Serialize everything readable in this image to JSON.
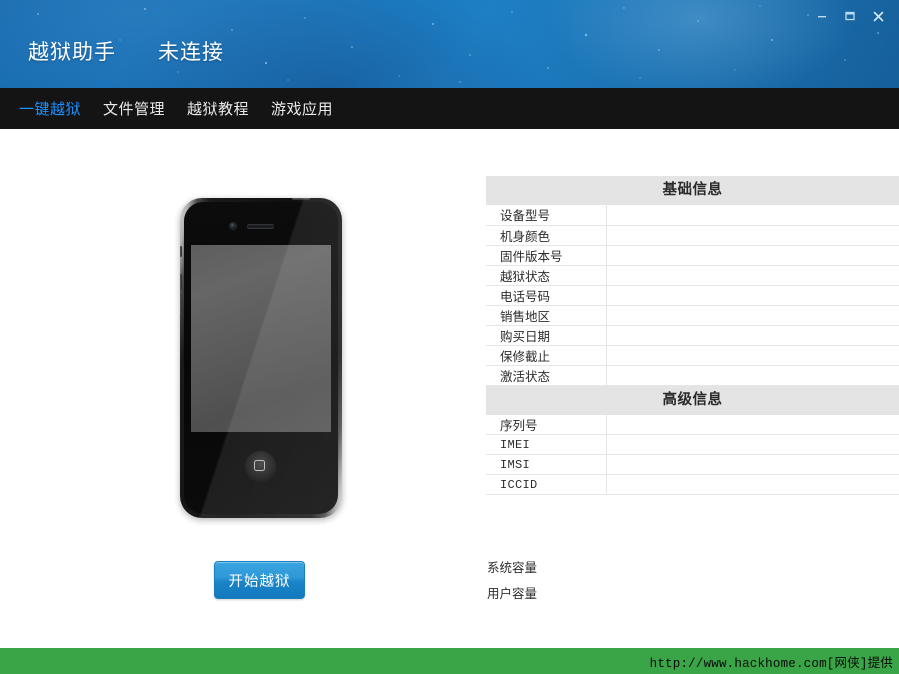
{
  "window": {
    "controls": [
      {
        "name": "minimize",
        "glyph": "minimize-icon"
      },
      {
        "name": "maximize",
        "glyph": "maximize-icon"
      },
      {
        "name": "close",
        "glyph": "close-icon"
      }
    ]
  },
  "header": {
    "title": "越狱助手",
    "status": "未连接",
    "background_color": "#1873b8"
  },
  "nav": {
    "background_color": "#141414",
    "active_color": "#1e90ff",
    "items": [
      {
        "label": "一键越狱",
        "active": true
      },
      {
        "label": "文件管理",
        "active": false
      },
      {
        "label": "越狱教程",
        "active": false
      },
      {
        "label": "游戏应用",
        "active": false
      }
    ]
  },
  "device_preview": {
    "icon": "iphone-device-illustration",
    "screen_color": "#5a5a5a",
    "body_color": "#101010"
  },
  "action": {
    "start_jailbreak_label": "开始越狱",
    "button_color": "#2594d4"
  },
  "basic_info": {
    "title": "基础信息",
    "rows": [
      {
        "label": "设备型号",
        "value": ""
      },
      {
        "label": "机身颜色",
        "value": ""
      },
      {
        "label": "固件版本号",
        "value": ""
      },
      {
        "label": "越狱状态",
        "value": ""
      },
      {
        "label": "电话号码",
        "value": ""
      },
      {
        "label": "销售地区",
        "value": ""
      },
      {
        "label": "购买日期",
        "value": ""
      },
      {
        "label": "保修截止",
        "value": ""
      },
      {
        "label": "激活状态",
        "value": ""
      }
    ]
  },
  "advanced_info": {
    "title": "高级信息",
    "rows": [
      {
        "label": "序列号",
        "value": "",
        "mono": false
      },
      {
        "label": "IMEI",
        "value": "",
        "mono": true
      },
      {
        "label": "IMSI",
        "value": "",
        "mono": true
      },
      {
        "label": "ICCID",
        "value": "",
        "mono": true
      }
    ]
  },
  "capacity": {
    "rows": [
      {
        "label": "系统容量",
        "value": ""
      },
      {
        "label": "用户容量",
        "value": ""
      }
    ]
  },
  "footer": {
    "text": "http://www.hackhome.com[网侠]提供",
    "background_color": "#3aa546"
  }
}
